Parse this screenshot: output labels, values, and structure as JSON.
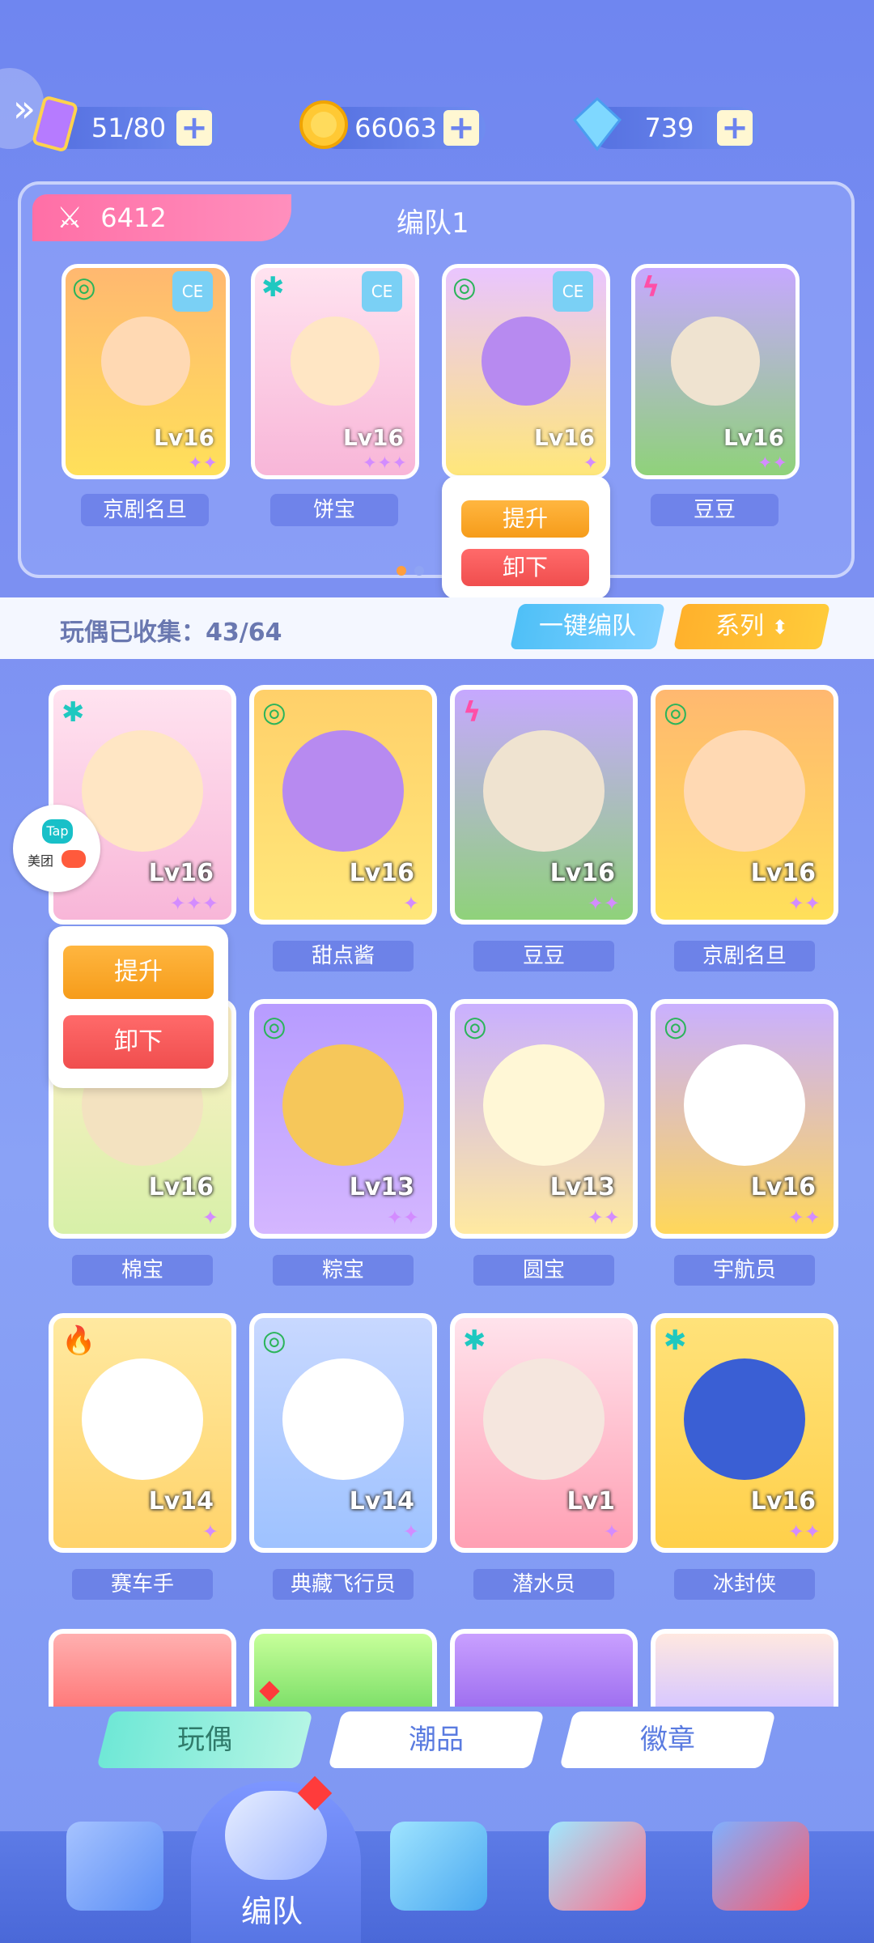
{
  "currencies": [
    {
      "value": "51/80",
      "icon": "stamina-card-icon"
    },
    {
      "value": "66063",
      "icon": "gold-coin-icon"
    },
    {
      "value": "739",
      "icon": "diamond-icon"
    }
  ],
  "team": {
    "power": "6412",
    "title": "编队1",
    "members": [
      {
        "name": "京剧名旦",
        "level": "Lv16"
      },
      {
        "name": "饼宝",
        "level": "Lv16"
      },
      {
        "name": "",
        "level": "Lv16"
      },
      {
        "name": "豆豆",
        "level": "Lv16"
      }
    ],
    "popup": {
      "upgrade": "提升",
      "unload": "卸下"
    }
  },
  "collection": {
    "text": "玩偶已收集：43/64",
    "one_key": "一键编队",
    "series": "系列"
  },
  "grid_popup": {
    "upgrade": "提升",
    "unload": "卸下"
  },
  "dolls": [
    {
      "name": "",
      "level": "Lv16",
      "stars": "✦✦✦",
      "elem": "✱"
    },
    {
      "name": "甜点酱",
      "level": "Lv16",
      "stars": "✦",
      "elem": "◎"
    },
    {
      "name": "豆豆",
      "level": "Lv16",
      "stars": "✦✦",
      "elem": "ϟ"
    },
    {
      "name": "京剧名旦",
      "level": "Lv16",
      "stars": "✦✦",
      "elem": "◎"
    },
    {
      "name": "棉宝",
      "level": "Lv16",
      "stars": "✦",
      "elem": ""
    },
    {
      "name": "粽宝",
      "level": "Lv13",
      "stars": "✦✦",
      "elem": "◎"
    },
    {
      "name": "圆宝",
      "level": "Lv13",
      "stars": "✦✦",
      "elem": "◎"
    },
    {
      "name": "宇航员",
      "level": "Lv16",
      "stars": "✦✦",
      "elem": "◎"
    },
    {
      "name": "赛车手",
      "level": "Lv14",
      "stars": "✦",
      "elem": "🔥"
    },
    {
      "name": "典藏飞行员",
      "level": "Lv14",
      "stars": "✦",
      "elem": "◎"
    },
    {
      "name": "潜水员",
      "level": "Lv1",
      "stars": "✦",
      "elem": "✱"
    },
    {
      "name": "冰封侠",
      "level": "Lv16",
      "stars": "✦✦",
      "elem": "✱"
    }
  ],
  "tabs": [
    "玩偶",
    "潮品",
    "徽章"
  ],
  "nav": {
    "active_label": "编队"
  },
  "tap_badge": {
    "line1": "Tap",
    "line2": "美团"
  }
}
